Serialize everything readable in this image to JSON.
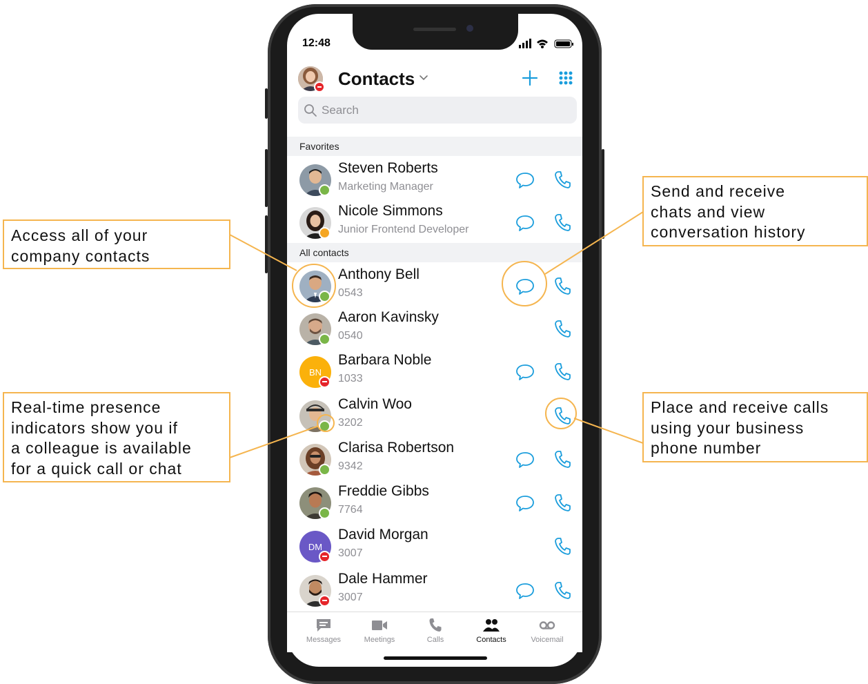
{
  "status_bar": {
    "time": "12:48"
  },
  "header": {
    "title": "Contacts",
    "add_icon": "plus-icon",
    "menu_icon": "grid-icon"
  },
  "search": {
    "placeholder": "Search"
  },
  "sections": {
    "favorites": "Favorites",
    "all_contacts": "All contacts"
  },
  "favorites": [
    {
      "name": "Steven Roberts",
      "subtitle": "Marketing Manager",
      "presence": "available",
      "chat": true
    },
    {
      "name": "Nicole Simmons",
      "subtitle": "Junior Frontend Developer",
      "presence": "away",
      "chat": true
    }
  ],
  "contacts": [
    {
      "name": "Anthony Bell",
      "subtitle": "0543",
      "presence": "available",
      "chat": true
    },
    {
      "name": "Aaron Kavinsky",
      "subtitle": "0540",
      "presence": "available",
      "chat": false
    },
    {
      "name": "Barbara Noble",
      "subtitle": "1033",
      "presence": "busy",
      "chat": true,
      "initials": "BN"
    },
    {
      "name": "Calvin Woo",
      "subtitle": "3202",
      "presence": "available",
      "chat": false
    },
    {
      "name": "Clarisa Robertson",
      "subtitle": "9342",
      "presence": "available",
      "chat": true
    },
    {
      "name": "Freddie Gibbs",
      "subtitle": "7764",
      "presence": "available",
      "chat": true
    },
    {
      "name": "David Morgan",
      "subtitle": "3007",
      "presence": "busy",
      "chat": false,
      "initials": "DM"
    },
    {
      "name": "Dale Hammer",
      "subtitle": "3007",
      "presence": "busy",
      "chat": true
    }
  ],
  "tabs": [
    {
      "label": "Messages",
      "icon": "message-icon"
    },
    {
      "label": "Meetings",
      "icon": "video-icon"
    },
    {
      "label": "Calls",
      "icon": "phone-icon"
    },
    {
      "label": "Contacts",
      "icon": "contacts-icon",
      "active": true
    },
    {
      "label": "Voicemail",
      "icon": "voicemail-icon"
    }
  ],
  "callouts": {
    "contacts": "Access all of your\ncompany contacts",
    "presence": "Real-time presence\nindicators show you if\na colleague is available\nfor a quick call or chat",
    "chat": "Send and receive\nchats and view\nconversation history",
    "calls": "Place and receive calls\nusing your business\nphone number"
  },
  "colors": {
    "accent": "#1a9ddc",
    "callout": "#f5b54f",
    "available": "#7ab648",
    "away": "#f5a623",
    "busy": "#e5252a",
    "bn_avatar": "#fbb10b",
    "dm_avatar": "#6a58c6"
  }
}
